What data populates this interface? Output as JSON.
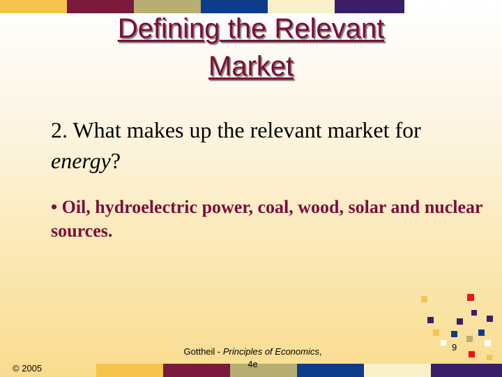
{
  "slide": {
    "title_line1": "Defining the Relevant",
    "title_line2": "Market",
    "question_prefix": "2. What makes up the relevant market for ",
    "question_emphasis": "energy",
    "question_suffix": "?",
    "answer": "• Oil, hydroelectric power, coal, wood, solar and nuclear sources."
  },
  "footer": {
    "copyright": "© 2005",
    "source_author": "Gottheil - ",
    "source_title": "Principles of Economics",
    "source_edition_line1": ",",
    "source_edition_line2": "4e",
    "page_number": "9"
  },
  "theme": {
    "title_color": "#7b0e3a",
    "answer_color": "#7b0e3a",
    "bar_colors": [
      "#f6c44d",
      "#7a1a3c",
      "#b8ad72",
      "#0d3c8a",
      "#f8f0c8",
      "#3a1f66"
    ],
    "square_colors": [
      "#f6c44d",
      "#e8141a",
      "#3a1f66",
      "#0d3c8a",
      "#b8ad72",
      "#ffffff"
    ]
  }
}
